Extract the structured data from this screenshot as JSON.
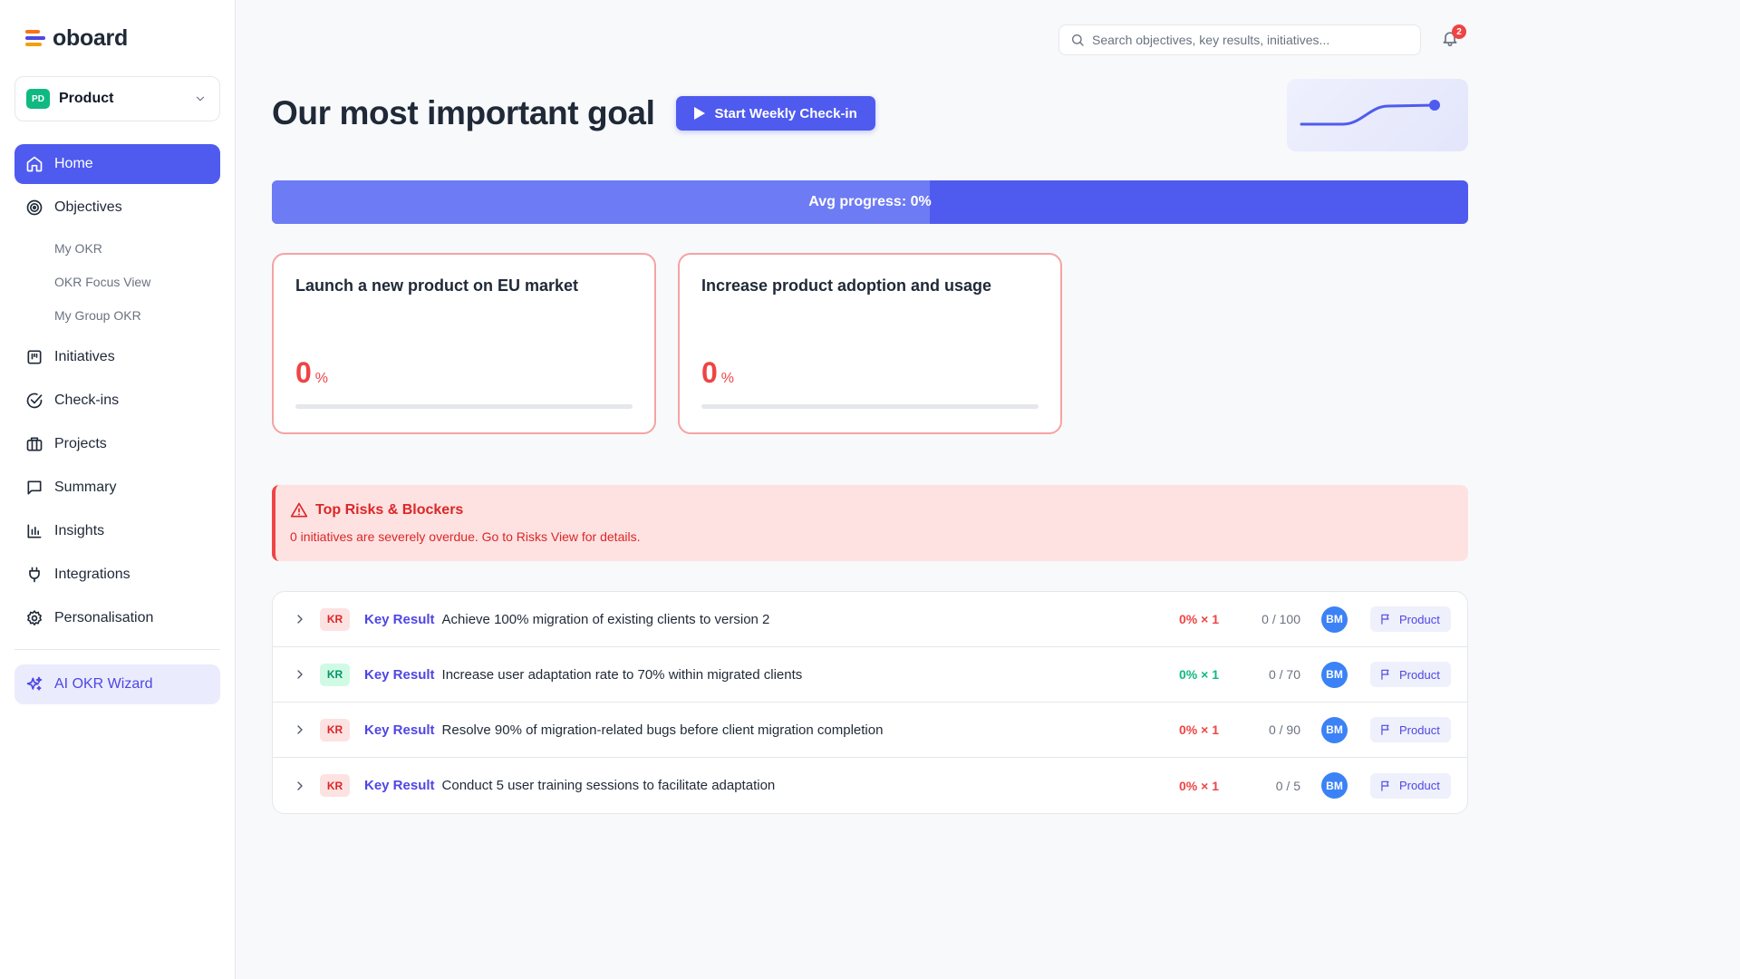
{
  "brand": {
    "name": "oboard"
  },
  "workspace": {
    "badge": "PD",
    "name": "Product"
  },
  "nav": {
    "home": "Home",
    "objectives": "Objectives",
    "sub": [
      "My OKR",
      "OKR Focus View",
      "My Group OKR"
    ],
    "initiatives": "Initiatives",
    "checkins": "Check-ins",
    "projects": "Projects",
    "summary": "Summary",
    "insights": "Insights",
    "integrations": "Integrations",
    "personalisation": "Personalisation",
    "ai_wizard": "AI OKR Wizard"
  },
  "search": {
    "placeholder": "Search objectives, key results, initiatives..."
  },
  "notifications": {
    "count": "2"
  },
  "header": {
    "title": "Our most important goal",
    "checkin_button": "Start Weekly Check-in"
  },
  "avg_progress": {
    "label": "Avg progress: 0%",
    "value": 0
  },
  "objectives": [
    {
      "title": "Launch a new product on EU market",
      "value": "0",
      "unit": "%",
      "progress": 0
    },
    {
      "title": "Increase product adoption and usage",
      "value": "0",
      "unit": "%",
      "progress": 0
    }
  ],
  "risks": {
    "title": "Top Risks & Blockers",
    "text": "0 initiatives are severely overdue. Go to Risks View for details."
  },
  "key_results": [
    {
      "badge": "KR",
      "badge_color": "red",
      "type": "Key Result",
      "title": "Achieve 100% migration of existing clients to version 2",
      "score": "0% × 1",
      "score_color": "red",
      "progress": "0 / 100",
      "owner": "BM",
      "tag": "Product"
    },
    {
      "badge": "KR",
      "badge_color": "green",
      "type": "Key Result",
      "title": "Increase user adaptation rate to 70% within migrated clients",
      "score": "0% × 1",
      "score_color": "green",
      "progress": "0 / 70",
      "owner": "BM",
      "tag": "Product"
    },
    {
      "badge": "KR",
      "badge_color": "red",
      "type": "Key Result",
      "title": "Resolve 90% of migration-related bugs before client migration completion",
      "score": "0% × 1",
      "score_color": "red",
      "progress": "0 / 90",
      "owner": "BM",
      "tag": "Product"
    },
    {
      "badge": "KR",
      "badge_color": "red",
      "type": "Key Result",
      "title": "Conduct 5 user training sessions to facilitate adaptation",
      "score": "0% × 1",
      "score_color": "red",
      "progress": "0 / 5",
      "owner": "BM",
      "tag": "Product"
    }
  ],
  "colors": {
    "accent": "#4f5bef",
    "danger": "#ef4444",
    "success": "#10b981",
    "avatar": "#3b82f6"
  }
}
